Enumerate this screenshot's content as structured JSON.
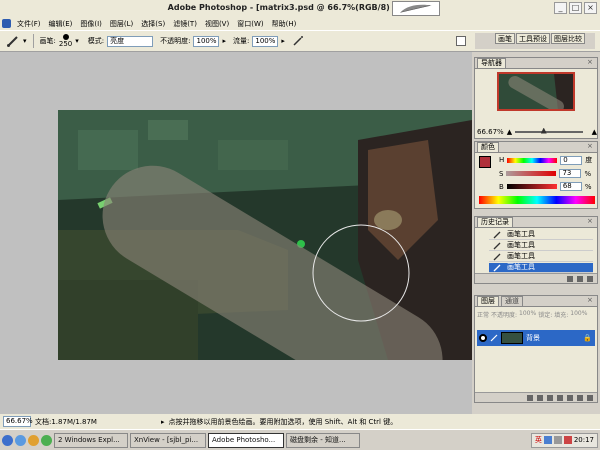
{
  "window": {
    "title": "Adobe Photoshop - [matrix3.psd @ 66.7%(RGB/8) [scaled]]",
    "controls": [
      "_",
      "□",
      "×"
    ]
  },
  "menu": [
    "文件(F)",
    "编辑(E)",
    "图像(I)",
    "图层(L)",
    "选择(S)",
    "滤镜(T)",
    "视图(V)",
    "窗口(W)",
    "帮助(H)"
  ],
  "options": {
    "brush_label": "画笔:",
    "brush_size": "250",
    "mode_label": "模式:",
    "mode_value": "亮度",
    "opacity_label": "不透明度:",
    "opacity_value": "100%",
    "flow_label": "流量:",
    "flow_value": "100%"
  },
  "palette_well": [
    "画笔",
    "工具预设",
    "图层比较"
  ],
  "navigator": {
    "tab": "导航器",
    "zoom": "66.67%"
  },
  "color": {
    "tab": "颜色",
    "h_label": "H",
    "h_value": "0",
    "h_unit": "度",
    "s_label": "S",
    "s_value": "73",
    "s_unit": "%",
    "b_label": "B",
    "b_value": "68",
    "b_unit": "%",
    "swatch": "#b0303a"
  },
  "history": {
    "tab": "历史记录",
    "items": [
      "画笔工具",
      "画笔工具",
      "画笔工具",
      "画笔工具"
    ],
    "selected_index": 3
  },
  "layers": {
    "tabs": [
      "图层",
      "通道"
    ],
    "blend_mode": "正常",
    "opacity_label": "不透明度:",
    "opacity_value": "100%",
    "lock_label": "锁定:",
    "fill_label": "填充:",
    "fill_value": "100%",
    "layer_name": "背景"
  },
  "status": {
    "zoom": "66.67%",
    "doc": "文档:1.87M/1.87M",
    "hint": "点按并拖移以用前景色绘画。要用附加选项，使用 Shift、Alt 和 Ctrl 键。"
  },
  "taskbar": {
    "items": [
      "2 Windows Expl...",
      "XnView - [sjbl_pi...",
      "Adobe Photosho...",
      "磁盘剩余 - 知道..."
    ],
    "active_index": 2,
    "ime": "英",
    "time": "20:17"
  },
  "colors": {
    "chrome": "#ece9d8",
    "accent": "#2c68c6",
    "canvas_bg": "#2f4a38"
  }
}
